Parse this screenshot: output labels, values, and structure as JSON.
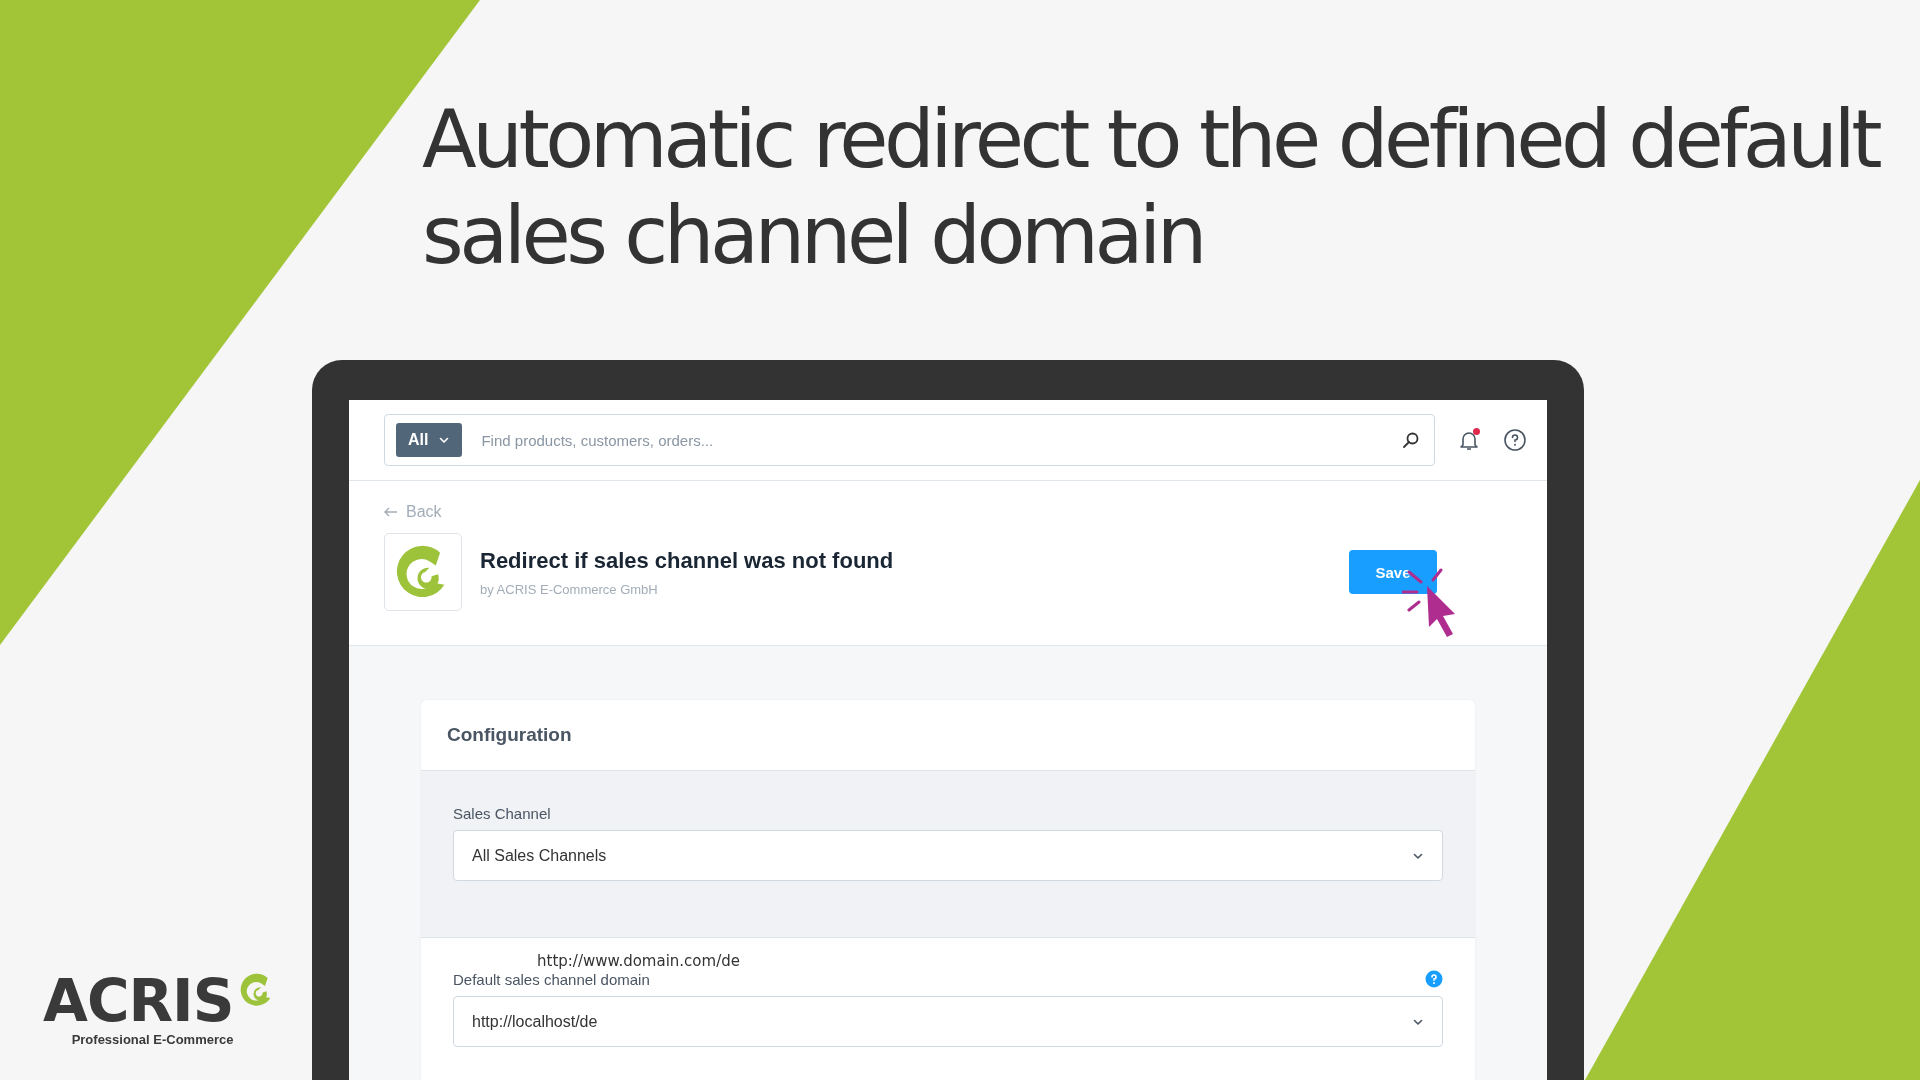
{
  "headline": "Automatic redirect to the defined default sales channel domain",
  "search": {
    "filter": "All",
    "placeholder": "Find products, customers, orders..."
  },
  "notifications": {
    "unread": true
  },
  "back": "Back",
  "plugin": {
    "title": "Redirect if sales channel was not found",
    "vendor": "by ACRIS E-Commerce GmbH"
  },
  "save_button": "Save",
  "card": {
    "title": "Configuration",
    "fields": [
      {
        "label": "Sales Channel",
        "value": "All Sales Channels",
        "help": false
      },
      {
        "label": "Default sales channel domain",
        "value": "http://localhost/de",
        "help": true
      }
    ]
  },
  "annotation": "http://www.domain.com/de",
  "brand": {
    "name": "ACRIS",
    "tagline": "Professional E-Commerce"
  }
}
